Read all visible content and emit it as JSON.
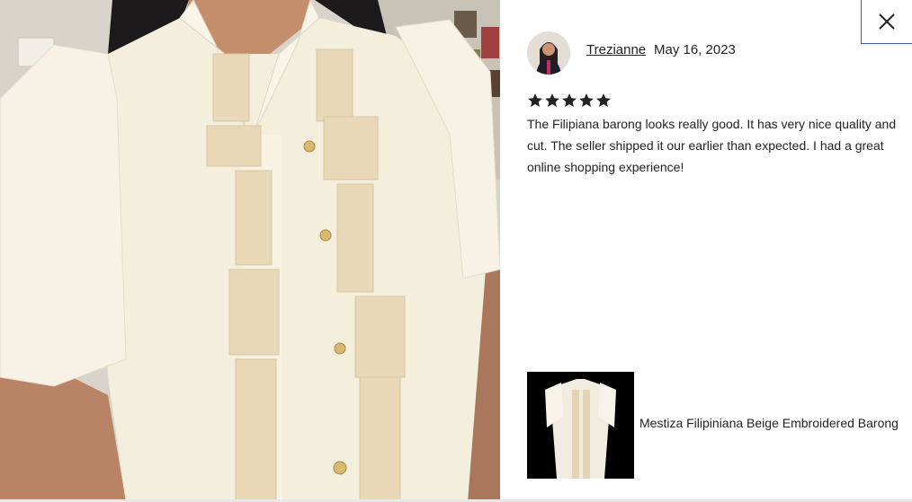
{
  "review": {
    "reviewer_name": "Trezianne",
    "date": "May 16, 2023",
    "rating": 5,
    "max_rating": 5,
    "text": "The Filipiana barong looks really good. It has very nice quality and cut. The seller shipped it our earlier than expected. I had a great online shopping experience!"
  },
  "item": {
    "title": "Mestiza Filipiniana Beige Embroidered Barong"
  },
  "icons": {
    "close": "close-icon",
    "star": "star-icon"
  },
  "colors": {
    "accent_border": "#3a5aa8",
    "text": "#222222",
    "fabric": "#f5efe0",
    "embroidery": "#e6d6b5"
  }
}
